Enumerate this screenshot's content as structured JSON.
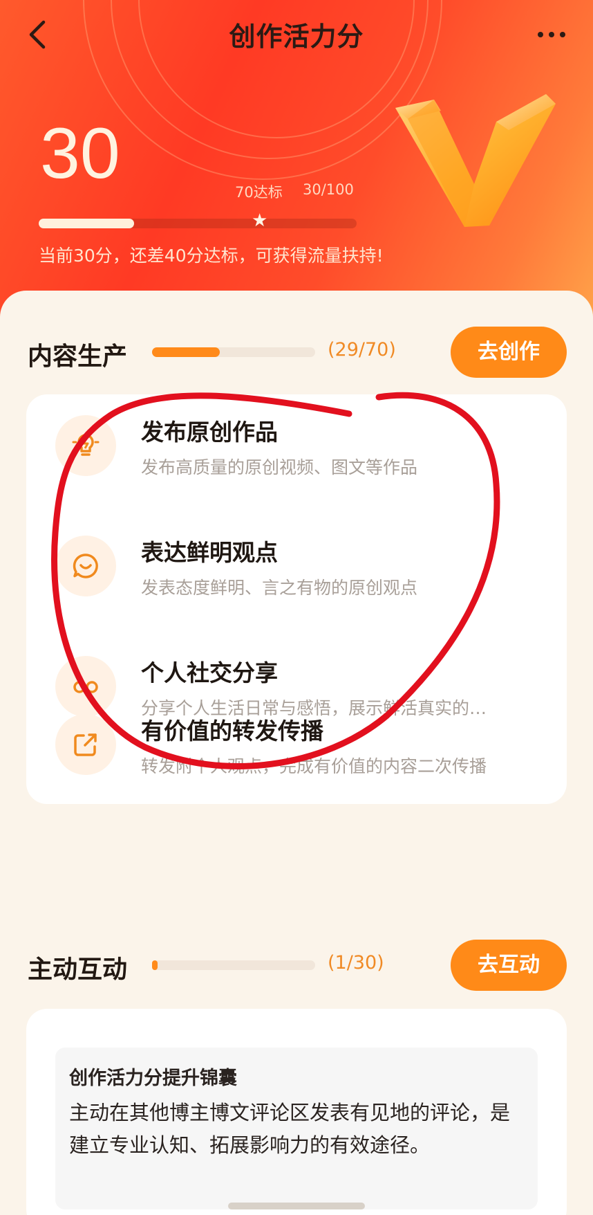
{
  "header": {
    "title": "创作活力分",
    "score": "30",
    "target_label": "70达标",
    "ratio_label": "30/100",
    "score_progress": 0.3,
    "target_progress": 0.7,
    "hint": "当前30分，还差40分达标，可获得流量扶持!"
  },
  "content_section": {
    "title": "内容生产",
    "count": "(29/70)",
    "progress": 0.414,
    "button_label": "去创作",
    "tasks": [
      {
        "title": "发布原创作品",
        "desc": "发布高质量的原创视频、图文等作品",
        "icon": "lightbulb-icon"
      },
      {
        "title": "表达鲜明观点",
        "desc": "发表态度鲜明、言之有物的原创观点",
        "icon": "chat-bubble-icon"
      },
      {
        "title": "个人社交分享",
        "desc": "分享个人生活日常与感悟，展示鲜活真实的…",
        "icon": "share-link-icon"
      },
      {
        "title": "有价值的转发传播",
        "desc": "转发附个人观点，完成有价值的内容二次传播",
        "icon": "forward-icon"
      }
    ]
  },
  "interaction_section": {
    "title": "主动互动",
    "count": "(1/30)",
    "progress": 0.033,
    "button_label": "去互动",
    "tip_title": "创作活力分提升锦囊",
    "tip_body": "主动在其他博主博文评论区发表有见地的评论，是建立专业认知、拓展影响力的有效途径。"
  },
  "colors": {
    "accent": "#ff8a18",
    "annotation": "#e2101e"
  }
}
